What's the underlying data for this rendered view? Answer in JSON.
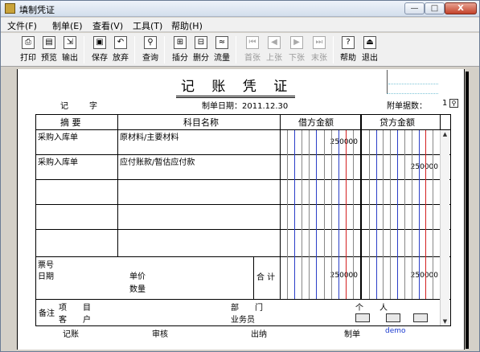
{
  "window": {
    "title": "填制凭证",
    "min": "—",
    "max": "□",
    "close": "X"
  },
  "menu": [
    "文件(F)",
    "制单(E)",
    "查看(V)",
    "工具(T)",
    "帮助(H)"
  ],
  "toolbar": [
    {
      "label": "打印",
      "icon": "printer-icon",
      "glyph": "⎙"
    },
    {
      "label": "预览",
      "icon": "preview-icon",
      "glyph": "▤"
    },
    {
      "label": "输出",
      "icon": "export-icon",
      "glyph": "⇲"
    },
    {
      "label": "保存",
      "icon": "save-icon",
      "glyph": "▣"
    },
    {
      "label": "放弃",
      "icon": "undo-icon",
      "glyph": "↶"
    },
    {
      "label": "查询",
      "icon": "binoculars-icon",
      "glyph": "⚲"
    },
    {
      "label": "插分",
      "icon": "insert-row-icon",
      "glyph": "⊞"
    },
    {
      "label": "删分",
      "icon": "delete-row-icon",
      "glyph": "⊟"
    },
    {
      "label": "流量",
      "icon": "cashflow-icon",
      "glyph": "≈"
    },
    {
      "label": "首张",
      "icon": "first-icon",
      "glyph": "⏮"
    },
    {
      "label": "上张",
      "icon": "prev-icon",
      "glyph": "◀"
    },
    {
      "label": "下张",
      "icon": "next-icon",
      "glyph": "▶"
    },
    {
      "label": "末张",
      "icon": "last-icon",
      "glyph": "⏭"
    },
    {
      "label": "帮助",
      "icon": "help-icon",
      "glyph": "?"
    },
    {
      "label": "退出",
      "icon": "exit-icon",
      "glyph": "⏏"
    }
  ],
  "voucher": {
    "title": "记 账 凭 证",
    "type_label": "记",
    "type_value": "字",
    "date": "制单日期：2011.12.30",
    "attach_label": "附单据数：",
    "attach_count": "1",
    "headers": {
      "summary": "摘 要",
      "account": "科目名称",
      "debit": "借方金额",
      "credit": "贷方金额"
    },
    "rows": [
      {
        "summary": "采购入库单",
        "account": "原材料/主要材料",
        "debit": "250000",
        "credit": ""
      },
      {
        "summary": "采购入库单",
        "account": "应付账款/暂估应付款",
        "debit": "",
        "credit": "250000"
      },
      {
        "summary": "",
        "account": "",
        "debit": "",
        "credit": ""
      },
      {
        "summary": "",
        "account": "",
        "debit": "",
        "credit": ""
      }
    ],
    "footer_box": {
      "ticket": "票号",
      "date": "日期",
      "unit_price": "单价",
      "quantity": "数量",
      "total_label": "合 计",
      "total_debit": "250000",
      "total_credit": "250000"
    },
    "remark": {
      "label": "备注",
      "project": "项　　目",
      "customer": "客　　户",
      "dept": "部　　门",
      "salesman": "业务员",
      "person": "个　　人"
    },
    "signatures": [
      "记账",
      "审核",
      "出纳",
      "制单"
    ],
    "maker": "demo"
  },
  "colors": {
    "blue_line": "#2b3fc8",
    "red_line": "#d42020",
    "grey_line": "#888888"
  }
}
